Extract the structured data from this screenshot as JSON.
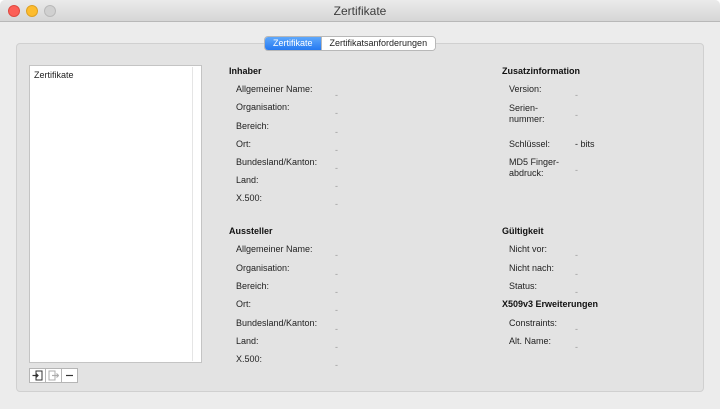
{
  "window": {
    "title": "Zertifikate"
  },
  "tabs": [
    {
      "label": "Zertifikate",
      "active": true
    },
    {
      "label": "Zertifikatsanforderungen",
      "active": false
    }
  ],
  "sidebar": {
    "items": [
      "Zertifikate"
    ],
    "buttons": [
      {
        "icon": "import-icon",
        "enabled": true
      },
      {
        "icon": "export-icon",
        "enabled": false
      },
      {
        "icon": "minus-icon",
        "enabled": true
      }
    ]
  },
  "inhaber": {
    "title": "Inhaber",
    "fields": [
      {
        "label": "Allgemeiner Name:",
        "value": "-"
      },
      {
        "label": "Organisation:",
        "value": "-"
      },
      {
        "label": "Bereich:",
        "value": "-"
      },
      {
        "label": "Ort:",
        "value": "-"
      },
      {
        "label": "Bundesland/Kanton:",
        "value": "-"
      },
      {
        "label": "Land:",
        "value": "-"
      },
      {
        "label": "X.500:",
        "value": "-"
      }
    ]
  },
  "aussteller": {
    "title": "Aussteller",
    "fields": [
      {
        "label": "Allgemeiner Name:",
        "value": "-"
      },
      {
        "label": "Organisation:",
        "value": "-"
      },
      {
        "label": "Bereich:",
        "value": "-"
      },
      {
        "label": "Ort:",
        "value": "-"
      },
      {
        "label": "Bundesland/Kanton:",
        "value": "-"
      },
      {
        "label": "Land:",
        "value": "-"
      },
      {
        "label": "X.500:",
        "value": "-"
      }
    ]
  },
  "zusatz": {
    "title": "Zusatzinformation",
    "version_label": "Version:",
    "version_value": "-",
    "serial_label_1": "Serien-",
    "serial_label_2": "nummer:",
    "serial_value": "-",
    "key_label": "Schlüssel:",
    "key_value": "- bits",
    "md5_label_1": "MD5 Finger-",
    "md5_label_2": "abdruck:",
    "md5_value": "-"
  },
  "gueltigkeit": {
    "title": "Gültigkeit",
    "fields": [
      {
        "label": "Nicht vor:",
        "value": "-"
      },
      {
        "label": "Nicht nach:",
        "value": "-"
      },
      {
        "label": "Status:",
        "value": "-"
      }
    ]
  },
  "x509": {
    "title": "X509v3 Erweiterungen",
    "fields": [
      {
        "label": "Constraints:",
        "value": "-"
      },
      {
        "label": "Alt. Name:",
        "value": "-"
      }
    ]
  }
}
